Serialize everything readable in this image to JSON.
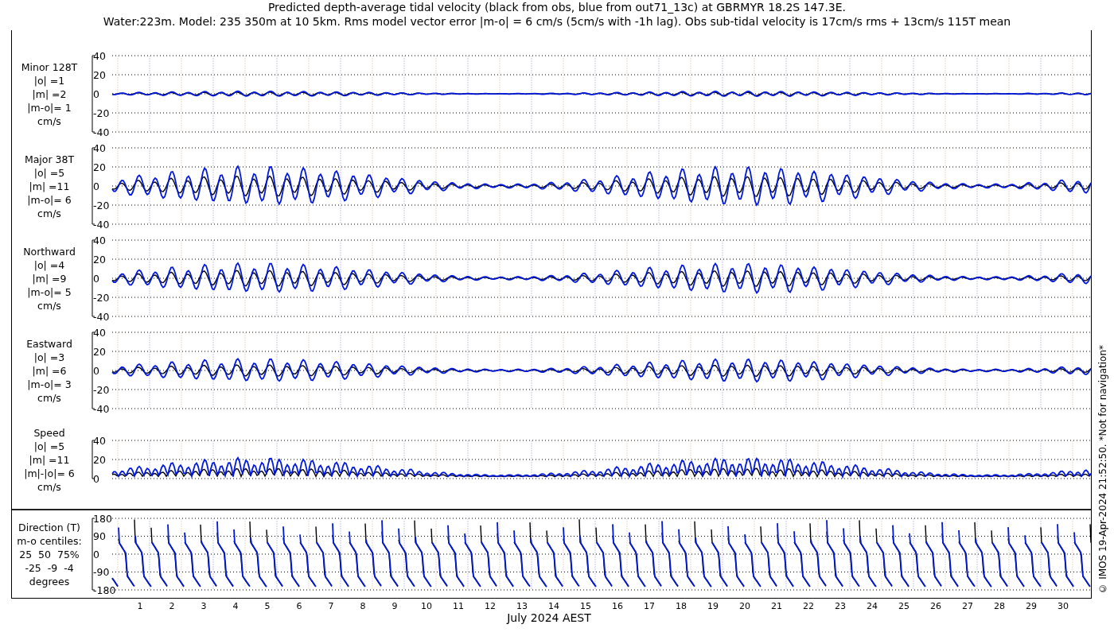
{
  "title_lines": [
    "Predicted depth-average tidal velocity (black from obs, blue from out71_13c) at GBRMYR 18.2S 147.3E.",
    "Water:223m. Model: 235 350m at 10 5km. Rms model vector error |m-o| = 6 cm/s (5cm/s with -1h lag). Obs sub-tidal velocity is 17cm/s rms + 13cm/s 115T mean"
  ],
  "panels": [
    {
      "kind": "velocity",
      "label_lines": [
        "Minor 128T",
        "|o| =1",
        "|m| =2",
        "|m-o|= 1",
        "cm/s"
      ],
      "yticks": [
        "40",
        "20",
        "0",
        "-20",
        "-40"
      ]
    },
    {
      "kind": "velocity",
      "label_lines": [
        "Major 38T",
        "|o| =5",
        "|m| =11",
        "|m-o|= 6",
        "cm/s"
      ],
      "yticks": [
        "40",
        "20",
        "0",
        "-20",
        "-40"
      ]
    },
    {
      "kind": "velocity",
      "label_lines": [
        "Northward",
        "|o| =4",
        "|m| =9",
        "|m-o|= 5",
        "cm/s"
      ],
      "yticks": [
        "40",
        "20",
        "0",
        "-20",
        "-40"
      ]
    },
    {
      "kind": "velocity",
      "label_lines": [
        "Eastward",
        "|o| =3",
        "|m| =6",
        "|m-o|= 3",
        "cm/s"
      ],
      "yticks": [
        "40",
        "20",
        "0",
        "-20",
        "-40"
      ]
    },
    {
      "kind": "speed",
      "label_lines": [
        "Speed",
        "|o| =5",
        "|m| =11",
        "|m|-|o|= 6",
        "cm/s"
      ],
      "yticks": [
        "40",
        "20",
        "0"
      ]
    },
    {
      "kind": "direction",
      "label_lines": [
        "Direction (T)",
        "m-o centiles:",
        "25  50  75%",
        "-25  -9  -4",
        "degrees"
      ],
      "yticks": [
        "180",
        "90",
        "0",
        "-90",
        "-180"
      ]
    }
  ],
  "x_axis": {
    "day_labels": [
      "1",
      "2",
      "3",
      "4",
      "5",
      "6",
      "7",
      "8",
      "9",
      "10",
      "11",
      "12",
      "13",
      "14",
      "15",
      "16",
      "17",
      "18",
      "19",
      "20",
      "21",
      "22",
      "23",
      "24",
      "25",
      "26",
      "27",
      "28",
      "29",
      "30"
    ],
    "label": "July 2024 AEST"
  },
  "credit": "© IMOS 19-Apr-2024 21:52:50. *Not for navigation*"
}
